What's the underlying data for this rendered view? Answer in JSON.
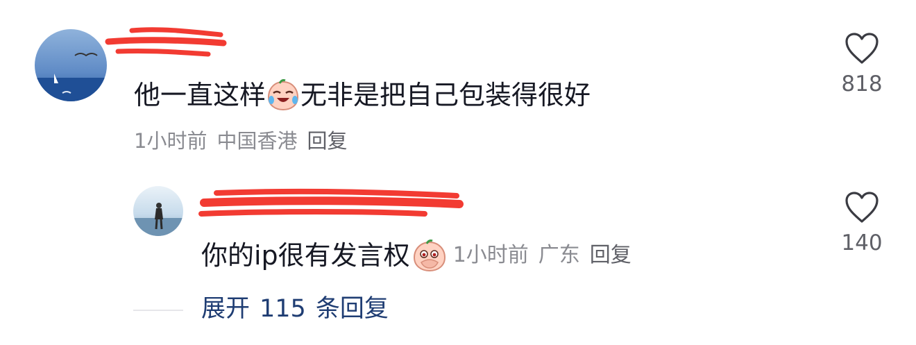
{
  "comment": {
    "text_before_emoji": "他一直这样",
    "text_after_emoji": "无非是把自己包装得很好",
    "time": "1小时前",
    "location": "中国香港",
    "reply_label": "回复",
    "like_count": "818"
  },
  "reply": {
    "text": "你的ip很有发言权",
    "time": "1小时前",
    "location": "广东",
    "reply_label": "回复",
    "like_count": "140"
  },
  "expand": {
    "label_prefix": "展开",
    "count": "115",
    "label_suffix": "条回复"
  },
  "colors": {
    "primary_text": "#161823",
    "meta_text": "#8a8b91",
    "link_text": "#1f3d73",
    "redaction": "#f23b32"
  },
  "icons": {
    "like": "heart-outline-icon",
    "emoji_1": "crying-laughing-peach-emoji",
    "emoji_2": "covering-mouth-peach-emoji"
  }
}
